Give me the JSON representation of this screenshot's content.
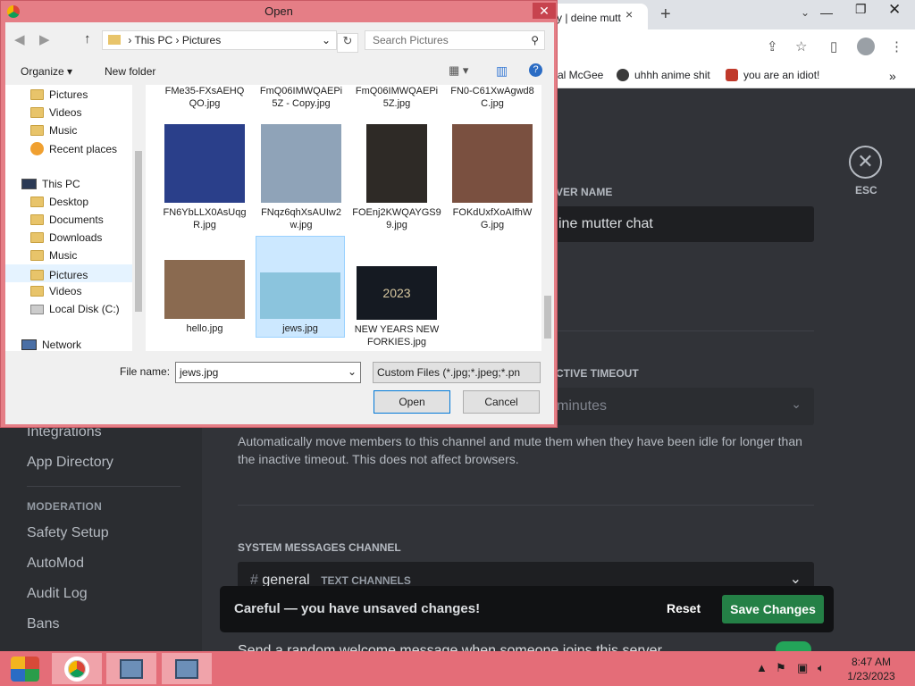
{
  "browser": {
    "tab_title": "y | deine mutt",
    "tab_close": "×",
    "new_tab": "+",
    "bookmarks": [
      {
        "label": "al McGee",
        "color": "#8a6d4a"
      },
      {
        "label": "uhhh anime shit",
        "color": "#3a3a3a"
      },
      {
        "label": "you are an idiot!",
        "color": "#c0392b"
      }
    ],
    "overflow": "»"
  },
  "discord": {
    "esc_label": "ESC",
    "server_name_heading": "VER NAME",
    "server_name_value": "ine mutter chat",
    "inactive_timeout_heading": "CTIVE TIMEOUT",
    "inactive_timeout_value": "minutes",
    "inactive_description": "Automatically move members to this channel and mute them when they have been idle for longer than the inactive timeout. This does not affect browsers.",
    "system_messages_heading": "SYSTEM MESSAGES CHANNEL",
    "system_channel_name": "general",
    "system_channel_category": "TEXT CHANNELS",
    "sidebar": {
      "items_top": [
        "Integrations",
        "App Directory"
      ],
      "moderation_heading": "MODERATION",
      "moderation_items": [
        "Safety Setup",
        "AutoMod",
        "Audit Log",
        "Bans"
      ]
    },
    "unsaved_bar": {
      "message": "Careful — you have unsaved changes!",
      "reset_label": "Reset",
      "save_label": "Save Changes"
    },
    "bottom_text": "Send a random welcome message when someone joins this server."
  },
  "dialog": {
    "title": "Open",
    "path": [
      "This PC",
      "Pictures"
    ],
    "search_placeholder": "Search Pictures",
    "organize_label": "Organize",
    "new_folder_label": "New folder",
    "nav_tree": [
      {
        "label": "Pictures",
        "icon": "folder-icon"
      },
      {
        "label": "Videos",
        "icon": "folder-icon"
      },
      {
        "label": "Music",
        "icon": "folder-icon"
      },
      {
        "label": "Recent places",
        "icon": "recent-icon"
      },
      {
        "label": "This PC",
        "icon": "computer-icon"
      },
      {
        "label": "Desktop",
        "icon": "folder-icon"
      },
      {
        "label": "Documents",
        "icon": "folder-icon"
      },
      {
        "label": "Downloads",
        "icon": "folder-icon"
      },
      {
        "label": "Music",
        "icon": "folder-icon"
      },
      {
        "label": "Pictures",
        "icon": "folder-icon",
        "selected": true
      },
      {
        "label": "Videos",
        "icon": "folder-icon"
      },
      {
        "label": "Local Disk (C:)",
        "icon": "disk-icon"
      },
      {
        "label": "Network",
        "icon": "network-icon"
      }
    ],
    "files_top_row": [
      {
        "name": "FMe35-FXsAEHQ QO.jpg"
      },
      {
        "name": "FmQ06IMWQAEPi 5Z - Copy.jpg"
      },
      {
        "name": "FmQ06IMWQAEPi 5Z.jpg"
      },
      {
        "name": "FN0-C61XwAgwd8 C.jpg"
      }
    ],
    "files_mid_row": [
      {
        "name": "FN6YbLLX0AsUqg R.jpg",
        "color": "#2a3f8a"
      },
      {
        "name": "FNqz6qhXsAUIw2 w.jpg",
        "color": "#8fa3b8"
      },
      {
        "name": "FOEnj2KWQAYGS9 9.jpg",
        "color": "#2e2a26"
      },
      {
        "name": "FOKdUxfXoAIfhW G.jpg",
        "color": "#7a5040"
      }
    ],
    "files_bottom_row": [
      {
        "name": "hello.jpg",
        "color": "#8a6a50"
      },
      {
        "name": "jews.jpg",
        "color": "#8bc4dd",
        "selected": true
      },
      {
        "name": "NEW YEARS NEW FORKIES.jpg",
        "color": "#151a22",
        "overlay": "2023"
      }
    ],
    "file_name_label": "File name:",
    "file_name_value": "jews.jpg",
    "file_type_value": "Custom Files (*.jpg;*.jpeg;*.pn",
    "open_label": "Open",
    "cancel_label": "Cancel"
  },
  "taskbar": {
    "time": "8:47 AM",
    "date": "1/23/2023",
    "accent": "#e46d78"
  }
}
